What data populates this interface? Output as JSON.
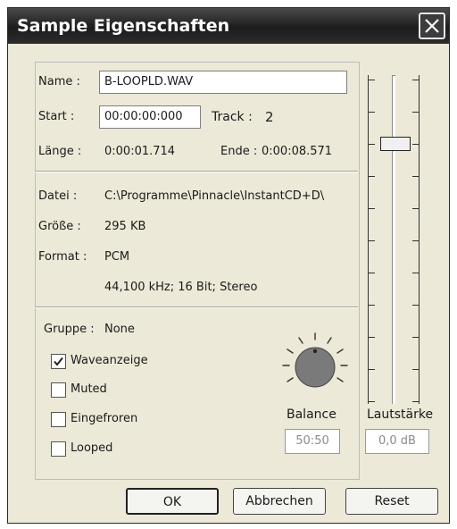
{
  "window": {
    "title": "Sample Eigenschaften"
  },
  "name": {
    "label": "Name :",
    "value": "B-LOOPLD.WAV"
  },
  "start": {
    "label": "Start :",
    "value": "00:00:00:000"
  },
  "track": {
    "label": "Track :",
    "value": "2"
  },
  "laenge": {
    "label": "Länge :",
    "value": "0:00:01.714"
  },
  "ende": {
    "label": "Ende :",
    "value": "0:00:08.571"
  },
  "datei": {
    "label": "Datei :",
    "value": "C:\\Programme\\Pinnacle\\InstantCD+D\\"
  },
  "groesse": {
    "label": "Größe :",
    "value": "295 KB"
  },
  "format": {
    "label": "Format :",
    "value": "PCM",
    "detail": "44,100 kHz; 16 Bit; Stereo"
  },
  "gruppe": {
    "label": "Gruppe :",
    "value": "None"
  },
  "checkboxes": [
    {
      "label": "Waveanzeige",
      "checked": true
    },
    {
      "label": "Muted",
      "checked": false
    },
    {
      "label": "Eingefroren",
      "checked": false
    },
    {
      "label": "Looped",
      "checked": false
    }
  ],
  "balance": {
    "label": "Balance",
    "value": "50:50"
  },
  "lautstaerke": {
    "label": "Lautstärke",
    "value": "0,0 dB",
    "level": 0.8
  },
  "buttons": {
    "ok": "OK",
    "cancel": "Abbrechen",
    "reset": "Reset"
  },
  "icons": {
    "close": "close-icon",
    "check": "checkmark-icon",
    "knob": "balance-knob"
  }
}
